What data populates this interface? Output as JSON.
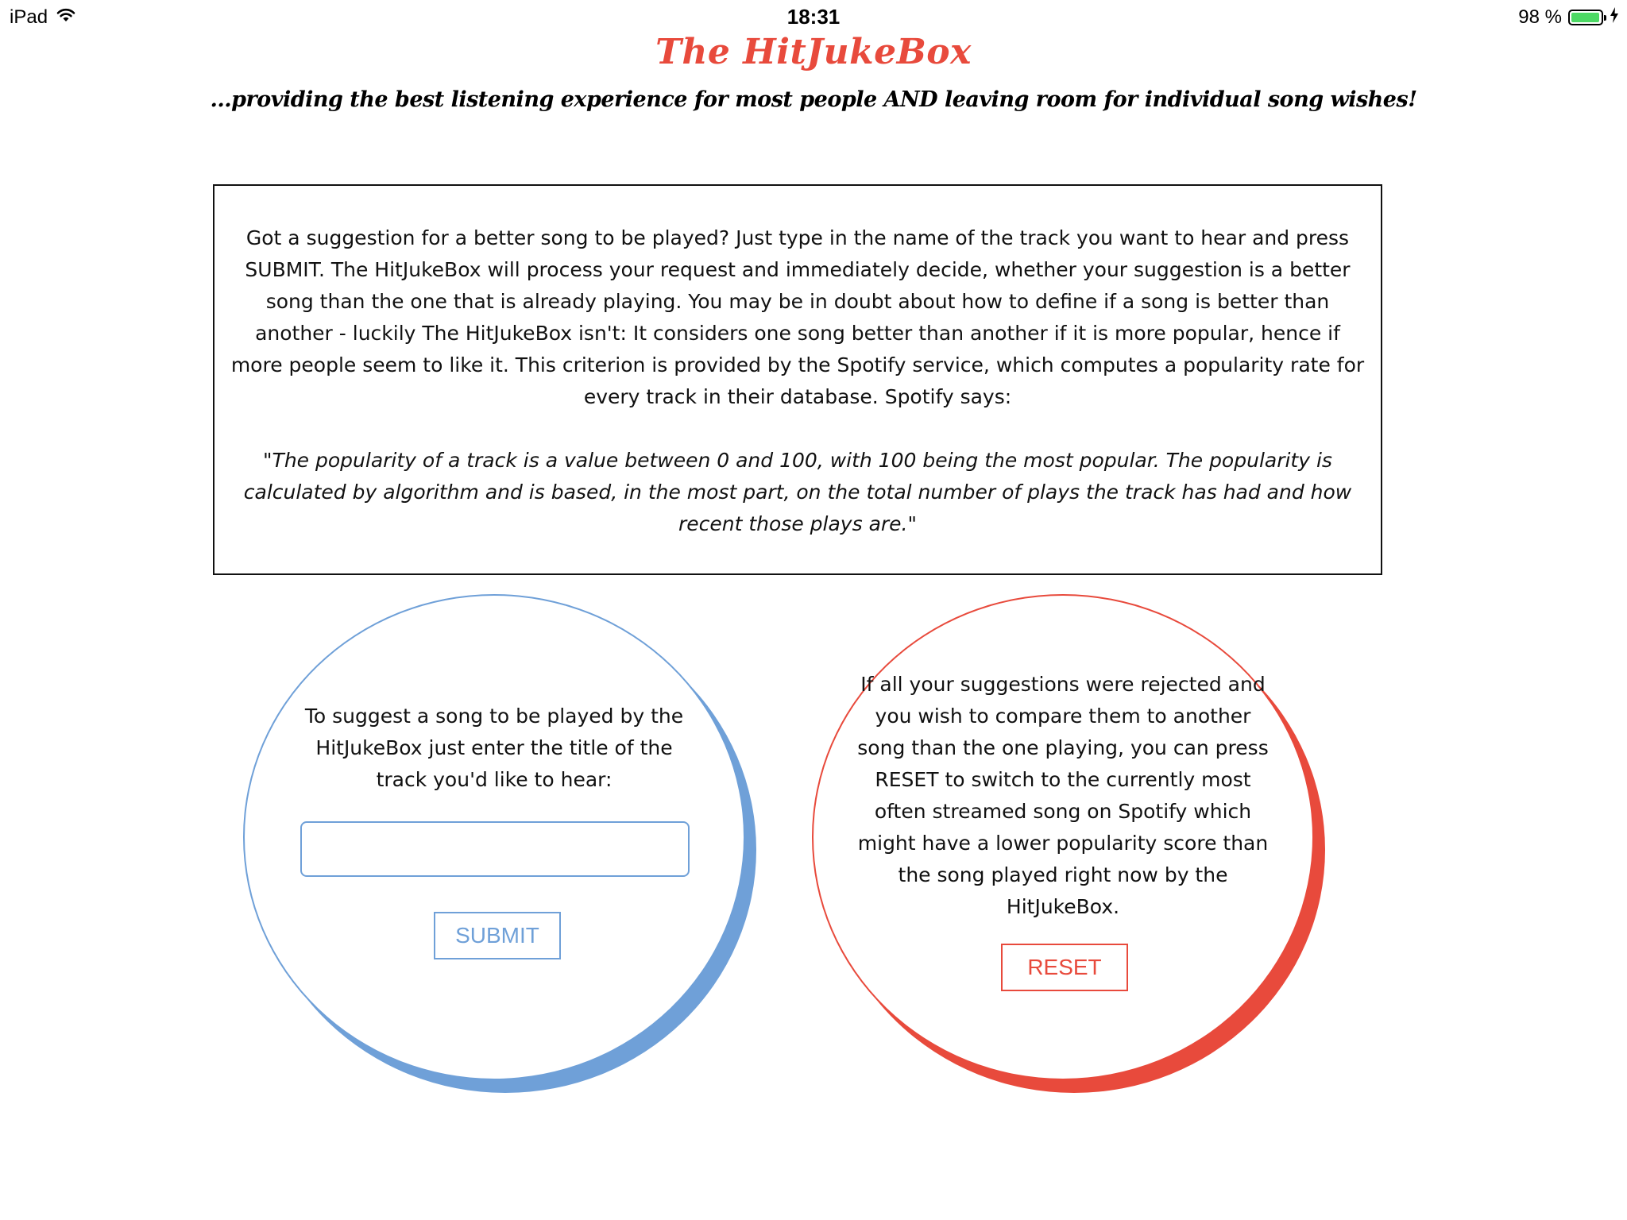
{
  "status_bar": {
    "device": "iPad",
    "time": "18:31",
    "battery_percent_text": "98 %",
    "battery_level": 0.98,
    "icons": [
      "wifi-icon",
      "battery-icon",
      "charging-bolt-icon"
    ]
  },
  "header": {
    "title": "The HitJukeBox",
    "tagline": "...providing the best listening experience for most people AND leaving room for individual song wishes!"
  },
  "info": {
    "paragraph": "Got a suggestion for a better song to be played? Just type in the name of the track you want to hear and press SUBMIT. The HitJukeBox will process your request and immediately decide, whether your suggestion is a better song than the one that is already playing. You may be in doubt about how to define if a song is better than another - luckily The HitJukeBox isn't: It considers one song better than another if it is more popular, hence if more people seem to like it. This criterion is provided by the Spotify service, which computes a popularity rate for every track in their database. Spotify says:",
    "quote": "\"The popularity of a track is a value between 0 and 100, with 100 being the most popular. The popularity is calculated by algorithm and is based, in the most part, on the total number of plays the track has had and how recent those plays are.\""
  },
  "suggest": {
    "text": "To suggest a song to be played by the HitJukeBox just enter the title of the track you'd like to hear:",
    "input_value": "",
    "input_placeholder": "",
    "submit_label": "SUBMIT"
  },
  "reset": {
    "text": "If all your suggestions were rejected and you wish to compare them to another song than the one playing, you can press RESET to switch to the currently most often streamed song on Spotify which might have a lower popularity score than the song played right now by the HitJukeBox.",
    "reset_label": "RESET"
  },
  "colors": {
    "accent_red": "#e84a3c",
    "accent_blue": "#6fa0d8",
    "battery_green": "#4cd964"
  }
}
